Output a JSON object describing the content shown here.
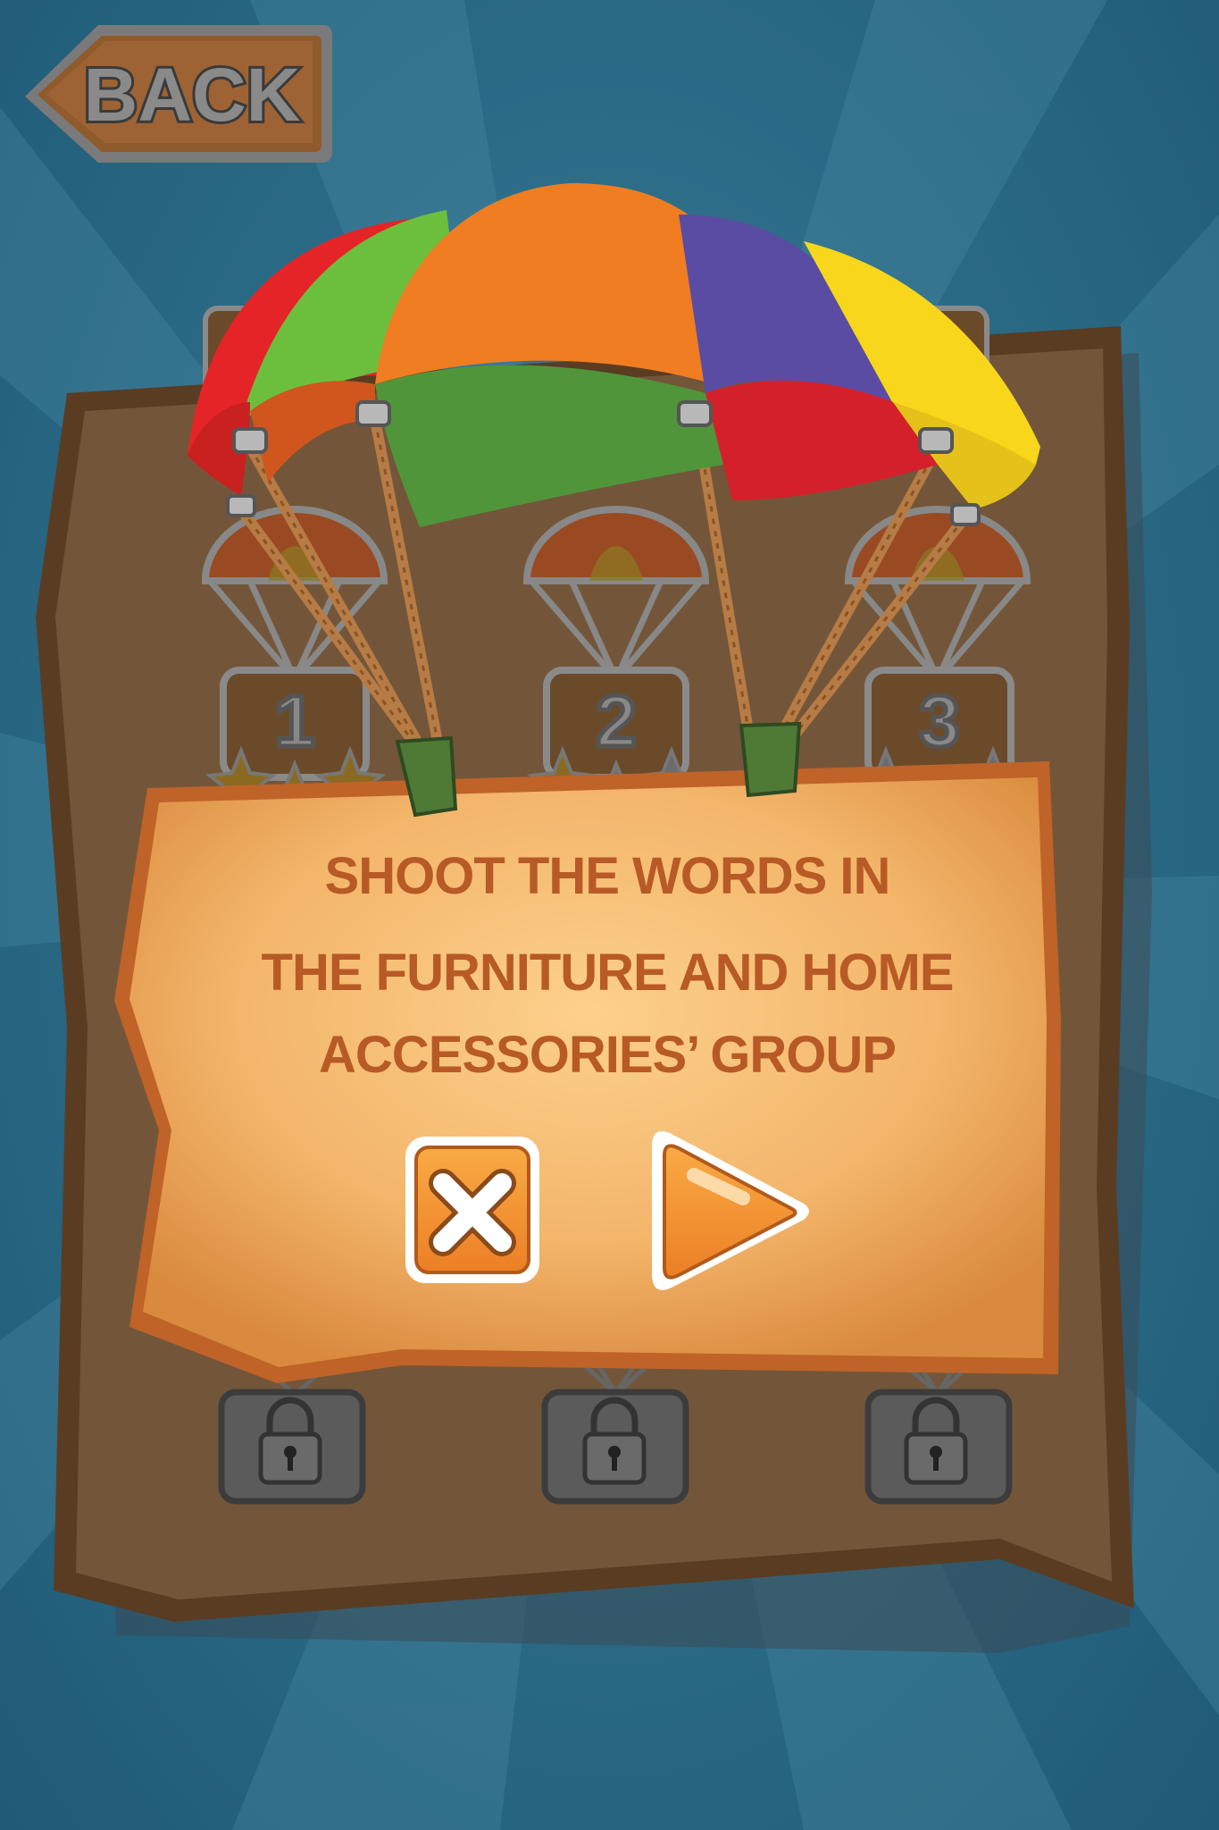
{
  "back_button": {
    "label": "BACK"
  },
  "levels": [
    {
      "number": "1",
      "stars_earned": 3,
      "stars_total": 3,
      "locked": false
    },
    {
      "number": "2",
      "stars_earned": 1,
      "stars_total": 3,
      "locked": false
    },
    {
      "number": "3",
      "stars_earned": 0,
      "stars_total": 3,
      "locked": false
    },
    {
      "number": "",
      "locked": true
    },
    {
      "number": "",
      "locked": true
    },
    {
      "number": "",
      "locked": true
    }
  ],
  "dialog": {
    "line1": "SHOOT THE WORDS IN",
    "line2": "THE FURNITURE AND HOME",
    "line3": "ACCESSORIES’ GROUP"
  },
  "buttons": {
    "close_icon": "close-x-icon",
    "play_icon": "play-triangle-icon"
  },
  "colors": {
    "background": "#2d6d88",
    "board": "#6e5235",
    "dialog_text": "#b85a25",
    "button_orange": "#f08a2b"
  }
}
